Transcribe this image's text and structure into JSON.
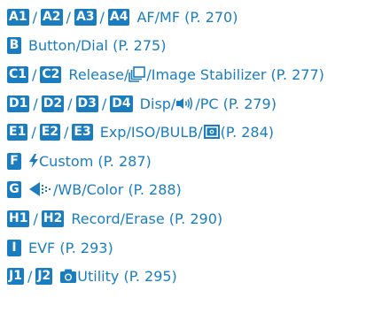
{
  "accent_color": "#1a7dc0",
  "rows": [
    {
      "badges": [
        "A1",
        "A2",
        "A3",
        "A4"
      ],
      "label": "AF/MF (P. 270)"
    },
    {
      "badges": [
        "B"
      ],
      "label": "Button/Dial (P. 275)"
    },
    {
      "badges": [
        "C1",
        "C2"
      ],
      "label_before_icon": "Release/",
      "icon": "sequential-shooting-icon",
      "label_after_icon": "/Image Stabilizer (P. 277)"
    },
    {
      "badges": [
        "D1",
        "D2",
        "D3",
        "D4"
      ],
      "label_before_icon": "Disp/",
      "icon": "beep-sound-icon",
      "label_after_icon": "/PC (P. 279)"
    },
    {
      "badges": [
        "E1",
        "E2",
        "E3"
      ],
      "label_before_icon": "Exp/ISO/BULB/",
      "icon": "metering-icon",
      "label_after_icon": " (P. 284)"
    },
    {
      "badges": [
        "F"
      ],
      "icon": "flash-icon",
      "label_after_icon": " Custom (P. 287)"
    },
    {
      "badges": [
        "G"
      ],
      "icon": "image-quality-icon",
      "label_after_icon": "/WB/Color (P. 288)"
    },
    {
      "badges": [
        "H1",
        "H2"
      ],
      "label": "Record/Erase (P. 290)"
    },
    {
      "badges": [
        "I"
      ],
      "label": "EVF (P. 293)"
    },
    {
      "badges": [
        "J1",
        "J2"
      ],
      "icon": "camera-icon",
      "label_after_icon": " Utility (P. 295)"
    }
  ]
}
